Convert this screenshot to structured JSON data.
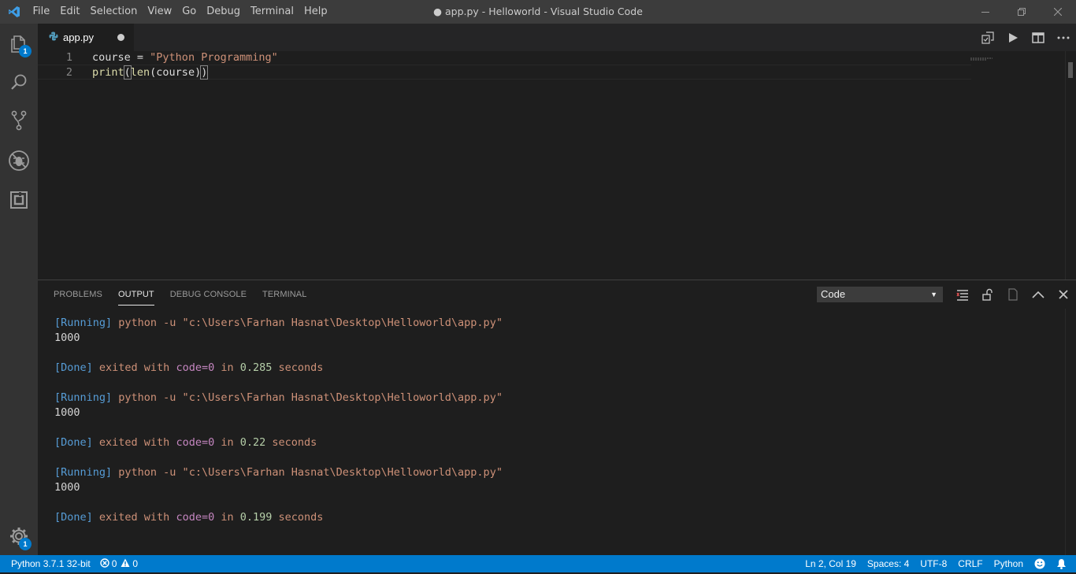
{
  "window": {
    "title": "● app.py - Helloworld - Visual Studio Code",
    "app_logo": "vscode-logo",
    "controls": [
      "minimize-icon",
      "restore-icon",
      "close-icon"
    ]
  },
  "menu": [
    "File",
    "Edit",
    "Selection",
    "View",
    "Go",
    "Debug",
    "Terminal",
    "Help"
  ],
  "activity_bar": {
    "items": [
      {
        "icon": "explorer-files-icon",
        "badge": "1"
      },
      {
        "icon": "search-icon"
      },
      {
        "icon": "source-control-icon"
      },
      {
        "icon": "debug-icon"
      },
      {
        "icon": "extensions-icon"
      }
    ],
    "manage": {
      "icon": "gear-icon",
      "badge": "1"
    }
  },
  "editor": {
    "tab": {
      "label": "app.py",
      "icon": "python-file-icon",
      "dirty": true
    },
    "actions": [
      "open-changes-icon",
      "run-icon",
      "split-editor-icon",
      "more-actions-icon"
    ],
    "lines": [
      {
        "number": "1",
        "tokens": [
          [
            "course",
            "id"
          ],
          [
            " = ",
            "id"
          ],
          [
            "\"Python Programming\"",
            "str"
          ]
        ]
      },
      {
        "number": "2",
        "tokens": [
          [
            "print",
            "fn"
          ],
          [
            "(",
            "brk"
          ],
          [
            "len",
            "fn"
          ],
          [
            "(course)",
            "id"
          ],
          [
            ")",
            "brk"
          ]
        ]
      }
    ]
  },
  "panel": {
    "tabs": [
      {
        "label": "PROBLEMS",
        "active": false
      },
      {
        "label": "OUTPUT",
        "active": true
      },
      {
        "label": "DEBUG CONSOLE",
        "active": false
      },
      {
        "label": "TERMINAL",
        "active": false
      }
    ],
    "output_channel": "Code",
    "actions": [
      "clear-output-icon",
      "lock-scroll-icon",
      "open-log-icon",
      "maximize-panel-icon",
      "close-panel-icon"
    ],
    "runs": [
      {
        "running": "[Running]",
        "command": " python -u \"c:\\Users\\Farhan Hasnat\\Desktop\\Helloworld\\app.py\"",
        "result": "1000",
        "done": "[Done]",
        "exited": " exited with ",
        "code": "code=0",
        "in": " in ",
        "seconds": "0.285",
        "unit": " seconds"
      },
      {
        "running": "[Running]",
        "command": " python -u \"c:\\Users\\Farhan Hasnat\\Desktop\\Helloworld\\app.py\"",
        "result": "1000",
        "done": "[Done]",
        "exited": " exited with ",
        "code": "code=0",
        "in": " in ",
        "seconds": "0.22",
        "unit": " seconds"
      },
      {
        "running": "[Running]",
        "command": " python -u \"c:\\Users\\Farhan Hasnat\\Desktop\\Helloworld\\app.py\"",
        "result": "1000",
        "done": "[Done]",
        "exited": " exited with ",
        "code": "code=0",
        "in": " in ",
        "seconds": "0.199",
        "unit": " seconds"
      }
    ]
  },
  "status": {
    "interpreter": "Python 3.7.1 32-bit",
    "errors": "0",
    "warnings": "0",
    "position": "Ln 2, Col 19",
    "spaces": "Spaces: 4",
    "encoding": "UTF-8",
    "eol": "CRLF",
    "language": "Python"
  },
  "colors": {
    "statusbar": "#007acc",
    "titlebar": "#3c3c3c",
    "activitybar": "#333333",
    "editor_bg": "#1e1e1e"
  }
}
